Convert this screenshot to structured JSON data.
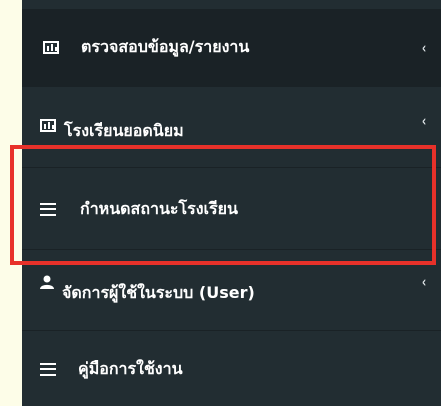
{
  "colors": {
    "sidebar_bg": "#222d32",
    "active_bg": "#1a2226",
    "text": "#ffffff",
    "highlight": "#e8312a"
  },
  "menu": [
    {
      "label": "ตรวจสอบข้อมูล/รายงาน",
      "icon": "bar-chart-icon",
      "has_submenu": true
    },
    {
      "label": "โรงเรียนยอดนิยม",
      "icon": "bar-chart-icon",
      "has_submenu": true
    },
    {
      "label": "กำหนดสถานะโรงเรียน",
      "icon": "bars-icon",
      "has_submenu": false
    },
    {
      "label": "จัดการผู้ใช้ในระบบ (User)",
      "icon": "user-icon",
      "has_submenu": true
    },
    {
      "label": "คู่มือการใช้งาน",
      "icon": "bars-icon",
      "has_submenu": false
    }
  ],
  "chevron": "‹"
}
